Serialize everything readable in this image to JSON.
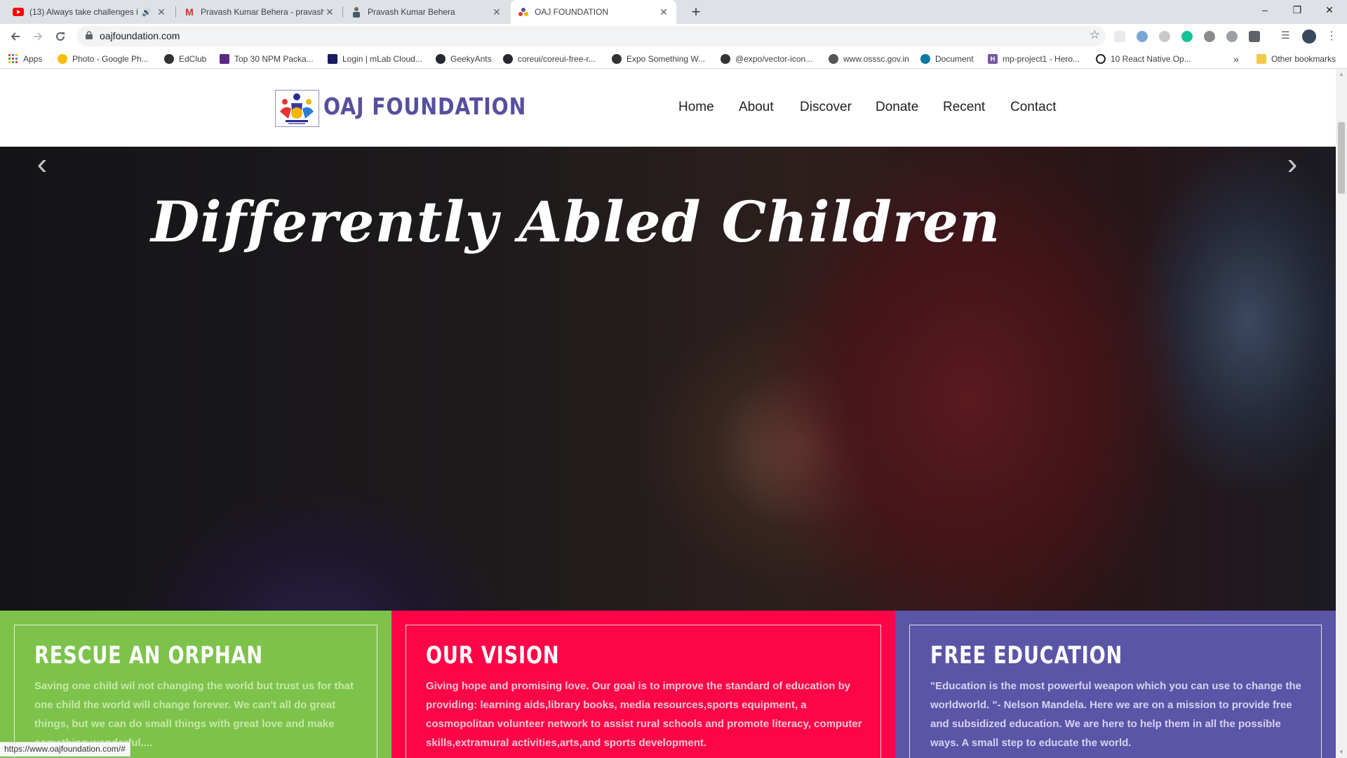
{
  "browser": {
    "tabs": [
      {
        "title": "(13) Always take challenges i",
        "icon": "youtube-icon",
        "active": false
      },
      {
        "title": "Pravash Kumar Behera - pravash",
        "icon": "gmail-icon",
        "active": false
      },
      {
        "title": "Pravash Kumar Behera",
        "icon": "profile-icon",
        "active": false
      },
      {
        "title": "OAJ FOUNDATION",
        "icon": "site-icon",
        "active": true
      }
    ],
    "new_tab": "+",
    "window_controls": {
      "minimize": "–",
      "restore": "❐",
      "close": "✕"
    },
    "url": "oajfoundation.com",
    "bookmarks": [
      {
        "label": "Apps",
        "icon": "apps-grid-icon",
        "color": "#e8453c"
      },
      {
        "label": "Photo - Google Ph...",
        "icon": "google-photos-icon",
        "color": "#fbbc05"
      },
      {
        "label": "EdClub",
        "icon": "edclub-icon",
        "color": "#333333"
      },
      {
        "label": "Top 30 NPM Packa...",
        "icon": "npm-icon",
        "color": "#5a2a82"
      },
      {
        "label": "Login | mLab Cloud...",
        "icon": "mlab-icon",
        "color": "#1a1a60"
      },
      {
        "label": "GeekyAnts",
        "icon": "github-icon",
        "color": "#24292e"
      },
      {
        "label": "coreui/coreui-free-r...",
        "icon": "github-icon",
        "color": "#24292e"
      },
      {
        "label": "Expo Something W...",
        "icon": "expo-icon",
        "color": "#333333"
      },
      {
        "label": "@expo/vector-icon...",
        "icon": "expo-icon",
        "color": "#333333"
      },
      {
        "label": "www.osssc.gov.in",
        "icon": "osssc-icon",
        "color": "#555555"
      },
      {
        "label": "Document",
        "icon": "react-icon",
        "color": "#0b7aa5"
      },
      {
        "label": "mp-project1 - Hero...",
        "icon": "heroku-icon",
        "color": "#79589f"
      },
      {
        "label": "10 React Native Op...",
        "icon": "quora-icon",
        "color": "#222222"
      }
    ],
    "more_bookmarks": "»",
    "other_bookmarks": "Other bookmarks",
    "status_url": "https://www.oajfoundation.com/#"
  },
  "site": {
    "logo_text": "OAJ FOUNDATION",
    "nav": [
      "Home",
      "About",
      "Discover",
      "Donate",
      "Recent",
      "Contact"
    ],
    "hero": {
      "title": "Differently Abled Children",
      "prev": "‹",
      "next": "›"
    },
    "cards": [
      {
        "title": "RESCUE AN ORPHAN",
        "text": "Saving one child wil not changing the world but trust us for that one child the world will change forever. We can't all do great things, but we can do small things with great love and make something wonderful....",
        "bg": "#7dc24b",
        "text_color": "#c5e8a6"
      },
      {
        "title": "OUR VISION",
        "text": "Giving hope and promising love. Our goal is to improve the standard of education by providing: learning aids,library books, media resources,sports equipment, a cosmopolitan volunteer network to assist rural schools and promote literacy, computer skills,extramural activities,arts,and sports development.",
        "bg": "#fd0546",
        "text_color": "#ffc7d5"
      },
      {
        "title": "FREE EDUCATION",
        "text": "\"Education is the most powerful weapon which you can use to change the worldworld. \"- Nelson Mandela. Here we are on a mission to provide free and subsidized education. We are here to help them in all the possible ways. A small step to educate the world.",
        "bg": "#5b55a7",
        "text_color": "#d5d2f0"
      }
    ]
  }
}
